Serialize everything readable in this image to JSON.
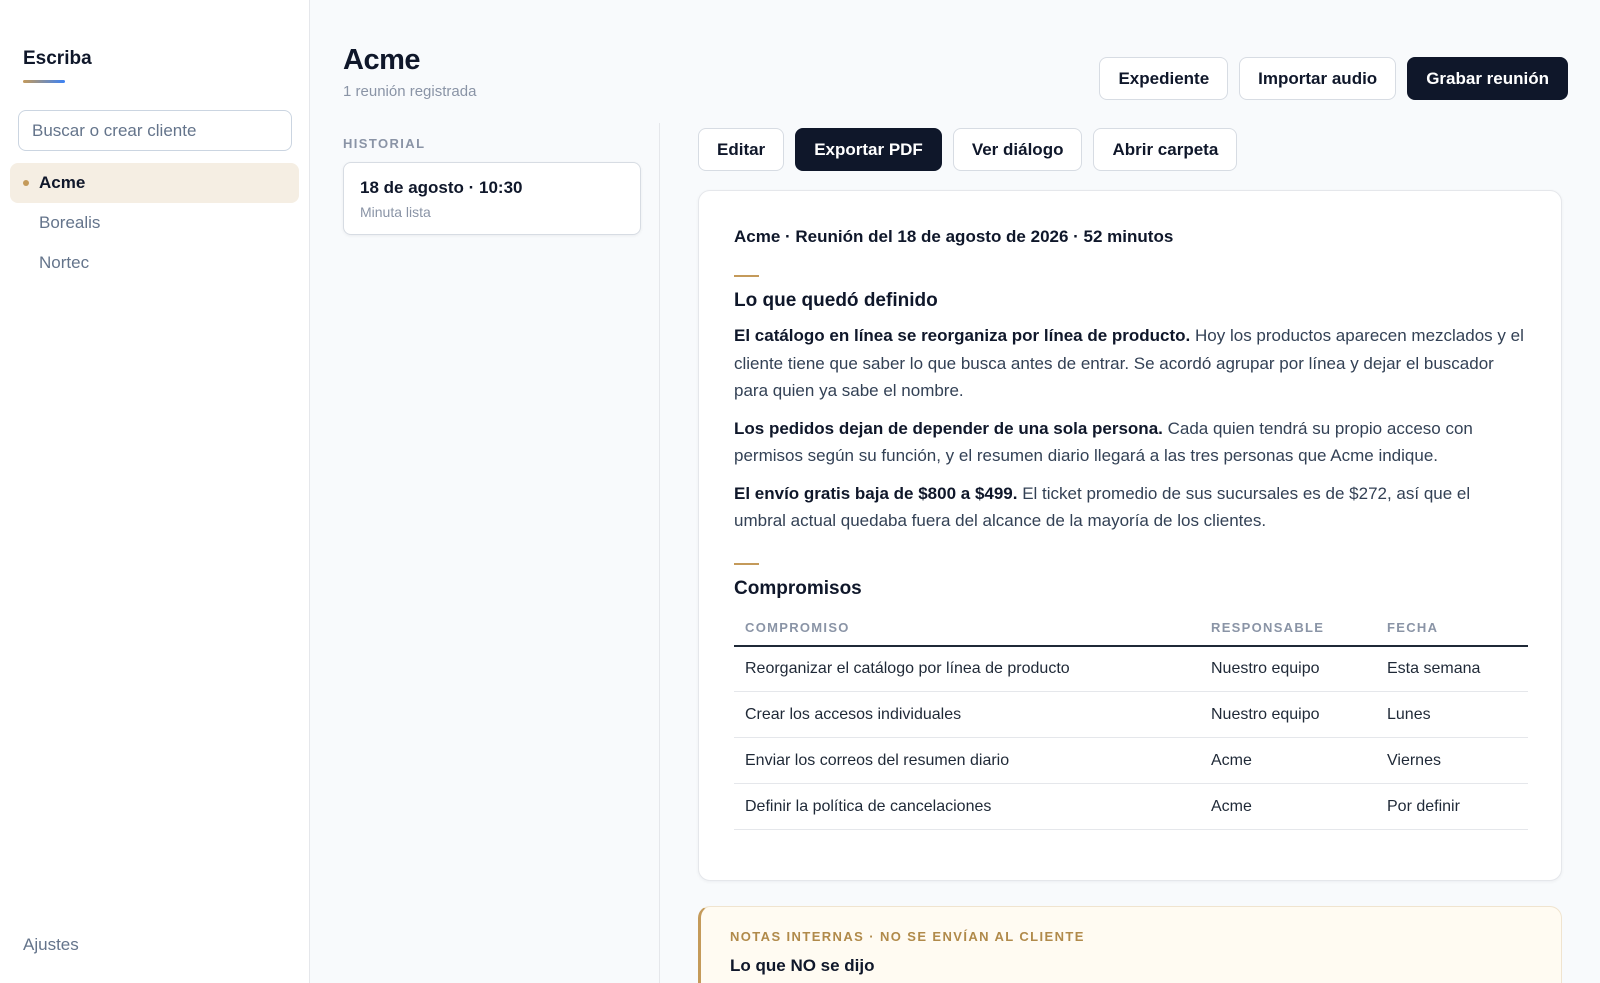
{
  "sidebar": {
    "brand": "Escriba",
    "search_placeholder": "Buscar o crear cliente",
    "clients": [
      {
        "label": "Acme",
        "active": true
      },
      {
        "label": "Borealis",
        "active": false
      },
      {
        "label": "Nortec",
        "active": false
      }
    ],
    "settings_label": "Ajustes"
  },
  "header": {
    "title": "Acme",
    "subtitle": "1 reunión registrada",
    "actions": {
      "expediente": "Expediente",
      "import_audio": "Importar audio",
      "record_meeting": "Grabar reunión"
    }
  },
  "history": {
    "label": "HISTORIAL",
    "items": [
      {
        "date": "18 de agosto · 10:30",
        "status": "Minuta lista"
      }
    ]
  },
  "toolbar": {
    "edit": "Editar",
    "export_pdf": "Exportar PDF",
    "view_dialog": "Ver diálogo",
    "open_folder": "Abrir carpeta"
  },
  "document": {
    "heading": "Acme · Reunión del 18 de agosto de 2026 · 52 minutos",
    "defined": {
      "title": "Lo que quedó definido",
      "items": [
        {
          "bold": "El catálogo en línea se reorganiza por línea de producto.",
          "text": " Hoy los productos aparecen mezclados y el cliente tiene que saber lo que busca antes de entrar. Se acordó agrupar por línea y dejar el buscador para quien ya sabe el nombre."
        },
        {
          "bold": "Los pedidos dejan de depender de una sola persona.",
          "text": " Cada quien tendrá su propio acceso con permisos según su función, y el resumen diario llegará a las tres personas que Acme indique."
        },
        {
          "bold": "El envío gratis baja de $800 a $499.",
          "text": " El ticket promedio de sus sucursales es de $272, así que el umbral actual quedaba fuera del alcance de la mayoría de los clientes."
        }
      ]
    },
    "commitments": {
      "title": "Compromisos",
      "columns": [
        "COMPROMISO",
        "RESPONSABLE",
        "FECHA"
      ],
      "rows": [
        [
          "Reorganizar el catálogo por línea de producto",
          "Nuestro equipo",
          "Esta semana"
        ],
        [
          "Crear los accesos individuales",
          "Nuestro equipo",
          "Lunes"
        ],
        [
          "Enviar los correos del resumen diario",
          "Acme",
          "Viernes"
        ],
        [
          "Definir la política de cancelaciones",
          "Acme",
          "Por definir"
        ]
      ]
    }
  },
  "notes": {
    "label": "NOTAS INTERNAS · NO SE ENVÍAN AL CLIENTE",
    "title": "Lo que NO se dijo"
  },
  "colors": {
    "accent": "#c49a5a",
    "primary_dark": "#0f172a",
    "active_bg": "#f5eee3",
    "notes_bg": "#fffbf2"
  }
}
